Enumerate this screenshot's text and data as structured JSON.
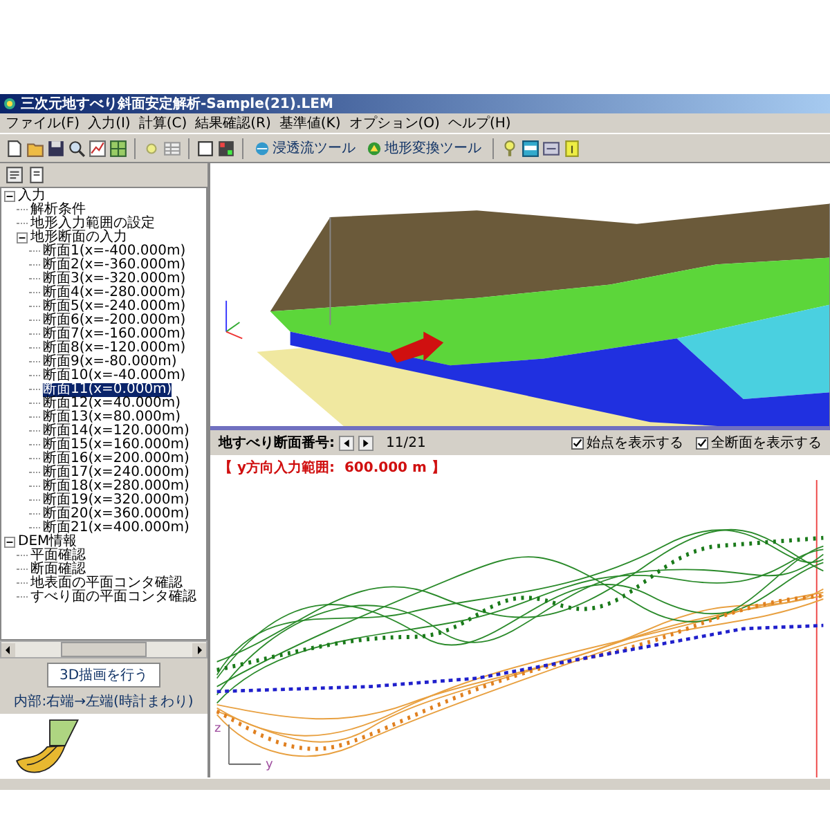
{
  "window": {
    "title": "三次元地すべり斜面安定解析-Sample(21).LEM"
  },
  "menu": [
    "ファイル(F)",
    "入力(I)",
    "計算(C)",
    "結果確認(R)",
    "基準値(K)",
    "オプション(O)",
    "ヘルプ(H)"
  ],
  "toolbar": {
    "tools": [
      "浸透流ツール",
      "地形変換ツール"
    ]
  },
  "tree": [
    {
      "label": "入力",
      "expanded": true,
      "selected": false,
      "children": [
        {
          "label": "解析条件",
          "selected": false
        },
        {
          "label": "地形入力範囲の設定",
          "selected": false
        },
        {
          "label": "地形断面の入力",
          "expanded": true,
          "selected": false,
          "children": [
            {
              "label": "断面1(x=-400.000m)",
              "selected": false
            },
            {
              "label": "断面2(x=-360.000m)",
              "selected": false
            },
            {
              "label": "断面3(x=-320.000m)",
              "selected": false
            },
            {
              "label": "断面4(x=-280.000m)",
              "selected": false
            },
            {
              "label": "断面5(x=-240.000m)",
              "selected": false
            },
            {
              "label": "断面6(x=-200.000m)",
              "selected": false
            },
            {
              "label": "断面7(x=-160.000m)",
              "selected": false
            },
            {
              "label": "断面8(x=-120.000m)",
              "selected": false
            },
            {
              "label": "断面9(x=-80.000m)",
              "selected": false
            },
            {
              "label": "断面10(x=-40.000m)",
              "selected": false
            },
            {
              "label": "断面11(x=0.000m)",
              "selected": true
            },
            {
              "label": "断面12(x=40.000m)",
              "selected": false
            },
            {
              "label": "断面13(x=80.000m)",
              "selected": false
            },
            {
              "label": "断面14(x=120.000m)",
              "selected": false
            },
            {
              "label": "断面15(x=160.000m)",
              "selected": false
            },
            {
              "label": "断面16(x=200.000m)",
              "selected": false
            },
            {
              "label": "断面17(x=240.000m)",
              "selected": false
            },
            {
              "label": "断面18(x=280.000m)",
              "selected": false
            },
            {
              "label": "断面19(x=320.000m)",
              "selected": false
            },
            {
              "label": "断面20(x=360.000m)",
              "selected": false
            },
            {
              "label": "断面21(x=400.000m)",
              "selected": false
            }
          ]
        }
      ]
    },
    {
      "label": "DEM情報",
      "expanded": true,
      "selected": false,
      "children": [
        {
          "label": "平面確認",
          "selected": false
        },
        {
          "label": "断面確認",
          "selected": false
        },
        {
          "label": "地表面の平面コンタ確認",
          "selected": false
        },
        {
          "label": "すべり面の平面コンタ確認",
          "selected": false
        }
      ]
    }
  ],
  "draw_button": "3D描画を行う",
  "direction_note": "内部:右端→左端(時計まわり)",
  "section_nav": {
    "label": "地すべり断面番号:",
    "counter": "11/21"
  },
  "options": [
    {
      "label": "始点を表示する",
      "checked": true
    },
    {
      "label": "全断面を表示する",
      "checked": true
    }
  ],
  "range_label": "【 y方向入力範囲:  600.000 m 】",
  "chart_axes": {
    "vertical": "z",
    "horizontal": "y"
  }
}
